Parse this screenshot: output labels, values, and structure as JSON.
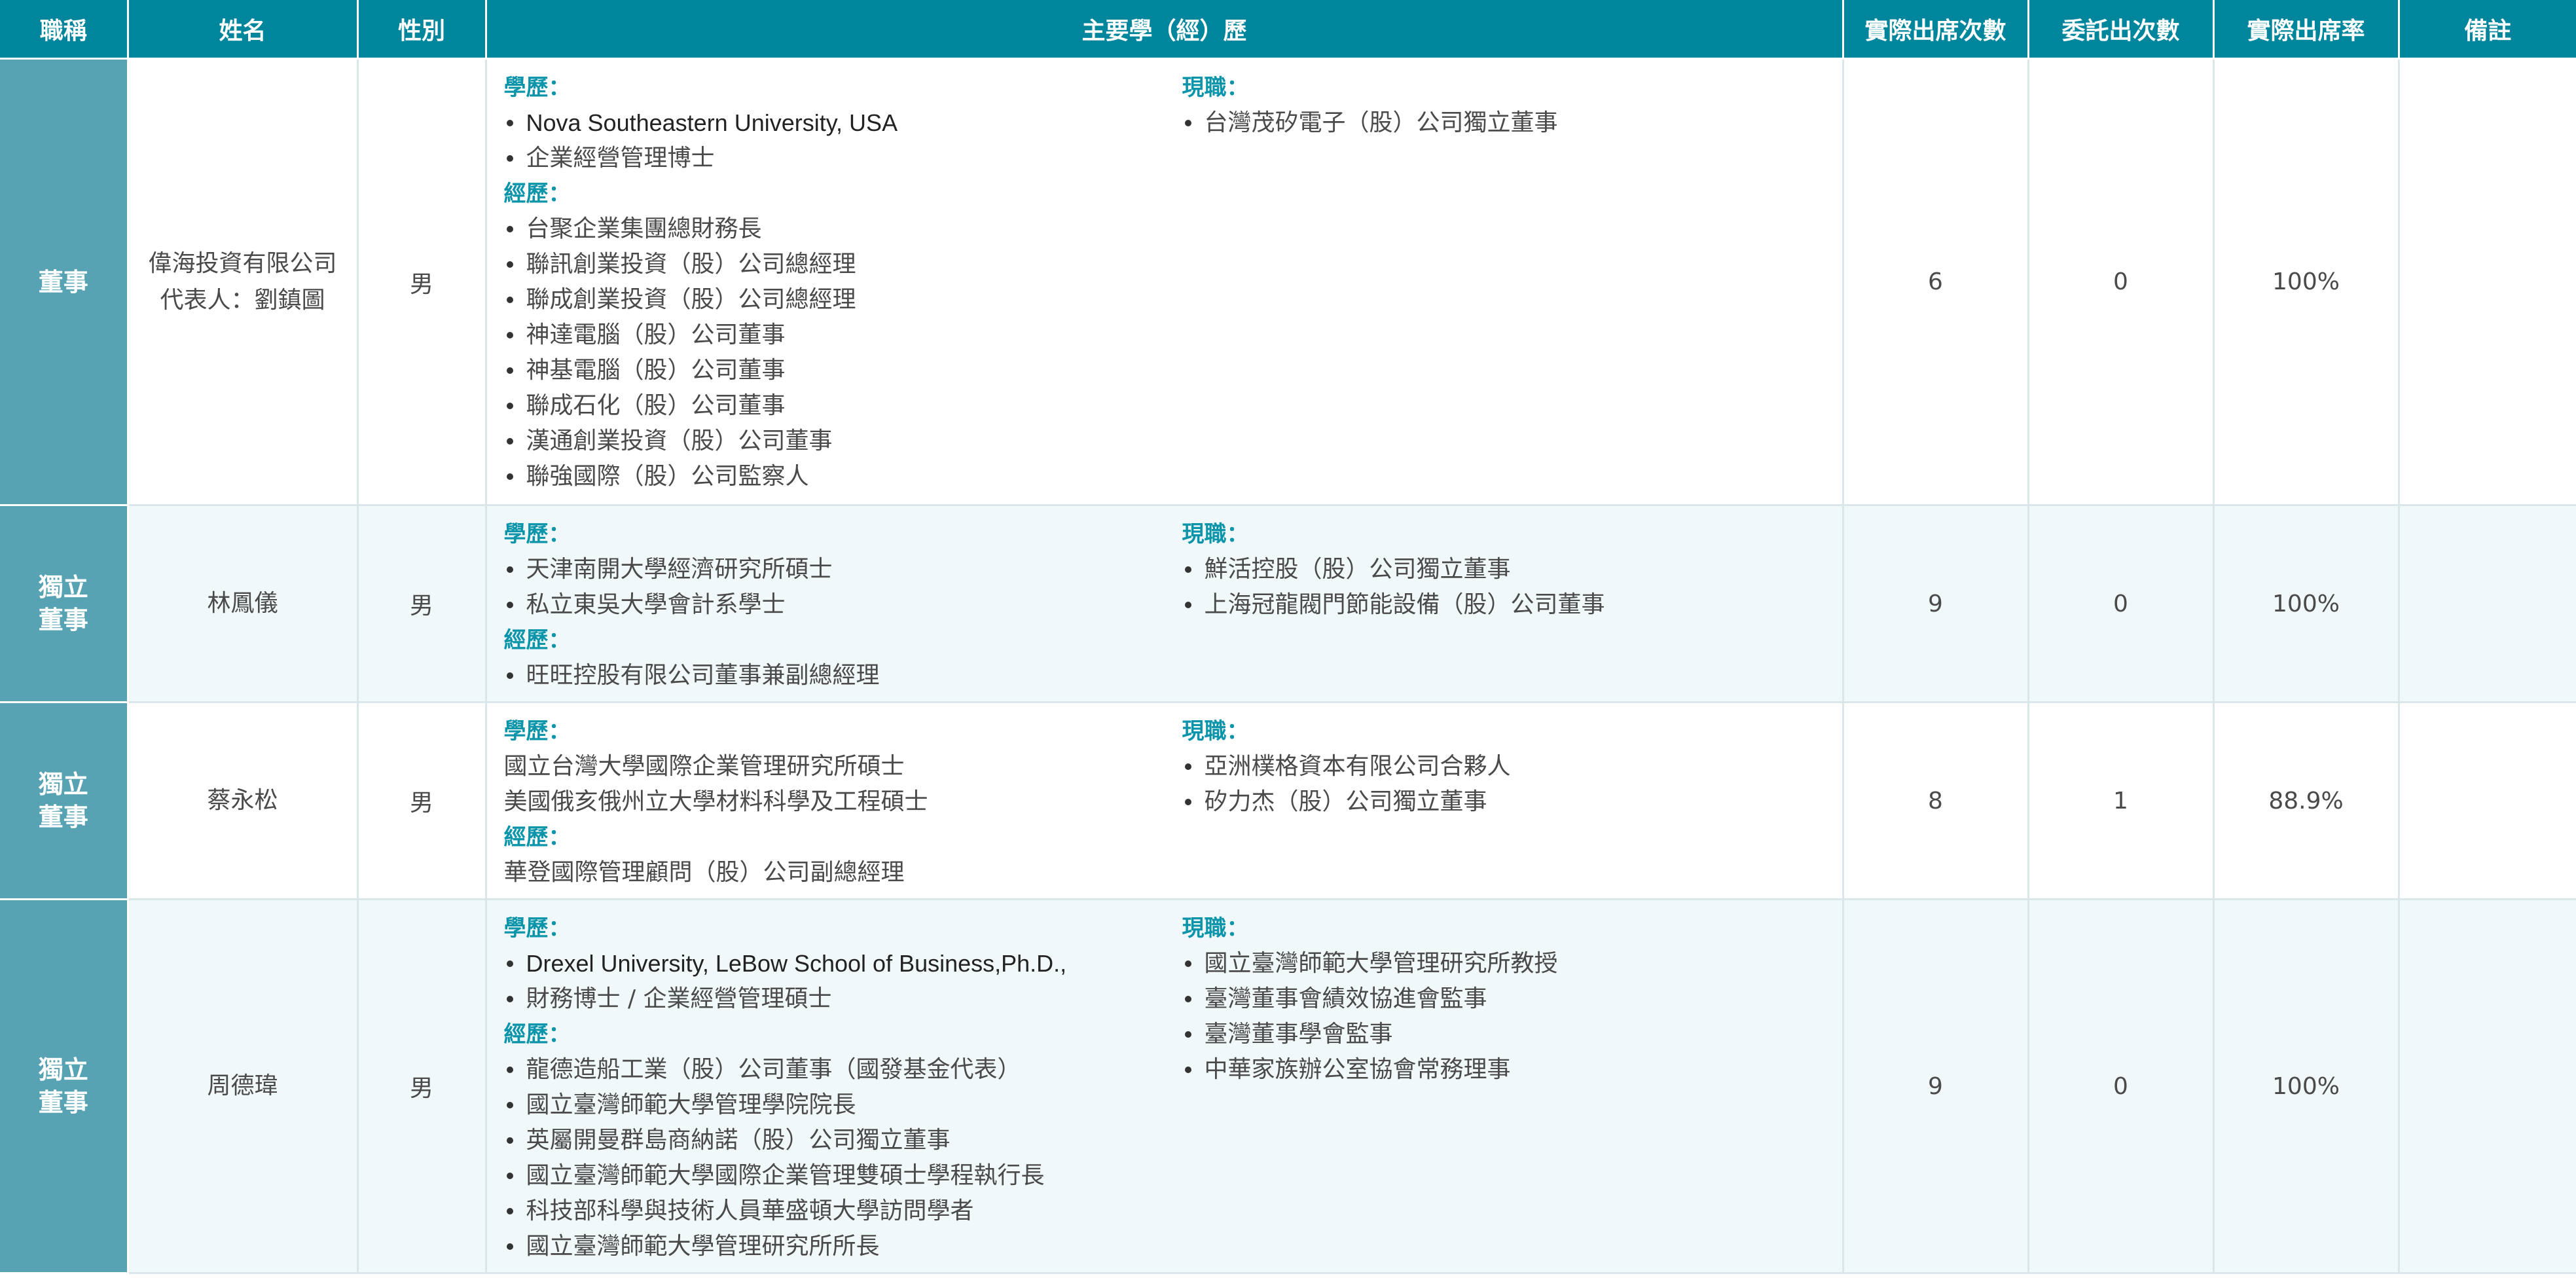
{
  "headers": [
    "職稱",
    "姓名",
    "性別",
    "主要學（經）歷",
    "實際出席次數",
    "委託出次數",
    "實際出席率",
    "備註"
  ],
  "labels": {
    "education": "學歷：",
    "experience": "經歷：",
    "current": "現職："
  },
  "rows": [
    {
      "title_lines": [
        "董事"
      ],
      "name_lines": [
        "偉海投資有限公司",
        "代表人：劉鎮圖"
      ],
      "gender": "男",
      "education": [
        {
          "text": "Nova Southeastern University, USA",
          "bullet": true,
          "latin": true
        },
        {
          "text": "企業經營管理博士",
          "bullet": true
        }
      ],
      "experience": [
        {
          "text": "台聚企業集團總財務長",
          "bullet": true
        },
        {
          "text": "聯訊創業投資（股）公司總經理",
          "bullet": true
        },
        {
          "text": "聯成創業投資（股）公司總經理",
          "bullet": true
        },
        {
          "text": "神達電腦（股）公司董事",
          "bullet": true
        },
        {
          "text": "神基電腦（股）公司董事",
          "bullet": true
        },
        {
          "text": "聯成石化（股）公司董事",
          "bullet": true
        },
        {
          "text": "漢通創業投資（股）公司董事",
          "bullet": true
        },
        {
          "text": "聯強國際（股）公司監察人",
          "bullet": true
        }
      ],
      "current": [
        {
          "text": "台灣茂矽電子（股）公司獨立董事",
          "bullet": true
        }
      ],
      "attendance": "6",
      "proxy": "0",
      "rate": "100%",
      "remark": ""
    },
    {
      "title_lines": [
        "獨立",
        "董事"
      ],
      "name_lines": [
        "林鳳儀"
      ],
      "gender": "男",
      "education": [
        {
          "text": "天津南開大學經濟研究所碩士",
          "bullet": true
        },
        {
          "text": "私立東吳大學會計系學士",
          "bullet": true
        }
      ],
      "experience": [
        {
          "text": "旺旺控股有限公司董事兼副總經理",
          "bullet": true
        }
      ],
      "current": [
        {
          "text": "鮮活控股（股）公司獨立董事",
          "bullet": true
        },
        {
          "text": "上海冠龍閥門節能設備（股）公司董事",
          "bullet": true
        }
      ],
      "attendance": "9",
      "proxy": "0",
      "rate": "100%",
      "remark": ""
    },
    {
      "title_lines": [
        "獨立",
        "董事"
      ],
      "name_lines": [
        "蔡永松"
      ],
      "gender": "男",
      "education": [
        {
          "text": "國立台灣大學國際企業管理研究所碩士",
          "bullet": false
        },
        {
          "text": "美國俄亥俄州立大學材料科學及工程碩士",
          "bullet": false
        }
      ],
      "experience": [
        {
          "text": "華登國際管理顧問（股）公司副總經理",
          "bullet": false
        }
      ],
      "current": [
        {
          "text": "亞洲樸格資本有限公司合夥人",
          "bullet": true
        },
        {
          "text": "矽力杰（股）公司獨立董事",
          "bullet": true
        }
      ],
      "attendance": "8",
      "proxy": "1",
      "rate": "88.9%",
      "remark": ""
    },
    {
      "title_lines": [
        "獨立",
        "董事"
      ],
      "name_lines": [
        "周德瑋"
      ],
      "gender": "男",
      "education": [
        {
          "text": "Drexel University, LeBow School of Business,Ph.D.,",
          "bullet": true,
          "latin": true
        },
        {
          "text": "財務博士 / 企業經營管理碩士",
          "bullet": true
        }
      ],
      "experience": [
        {
          "text": "龍德造船工業（股）公司董事（國發基金代表）",
          "bullet": true
        },
        {
          "text": "國立臺灣師範大學管理學院院長",
          "bullet": true
        },
        {
          "text": "英屬開曼群島商納諾（股）公司獨立董事",
          "bullet": true
        },
        {
          "text": "國立臺灣師範大學國際企業管理雙碩士學程執行長",
          "bullet": true
        },
        {
          "text": "科技部科學與技術人員華盛頓大學訪問學者",
          "bullet": true
        },
        {
          "text": "國立臺灣師範大學管理研究所所長",
          "bullet": true
        }
      ],
      "current": [
        {
          "text": "國立臺灣師範大學管理研究所教授",
          "bullet": true
        },
        {
          "text": "臺灣董事會績效協進會監事",
          "bullet": true
        },
        {
          "text": "臺灣董事學會監事",
          "bullet": true
        },
        {
          "text": "中華家族辦公室協會常務理事",
          "bullet": true
        }
      ],
      "attendance": "9",
      "proxy": "0",
      "rate": "100%",
      "remark": ""
    }
  ]
}
